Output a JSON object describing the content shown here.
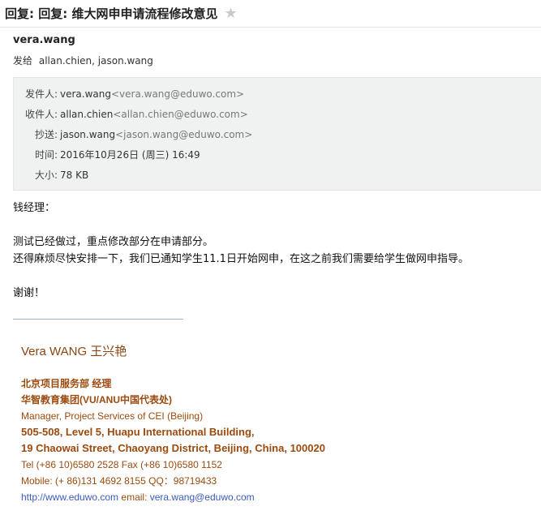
{
  "subject": "回复: 回复: 维大网申申请流程修改意见",
  "sender": "vera.wang",
  "to_line": {
    "label": "发给",
    "value": "allan.chien, jason.wang"
  },
  "details": [
    {
      "label": "发件人:",
      "value": "vera.wang",
      "addr": "<vera.wang@eduwo.com>"
    },
    {
      "label": "收件人:",
      "value": "allan.chien",
      "addr": "<allan.chien@eduwo.com>"
    },
    {
      "label": "抄送:",
      "value": "jason.wang",
      "addr": "<jason.wang@eduwo.com>"
    },
    {
      "label": "时间:",
      "value": "2016年10月26日 (周三) 16:49",
      "addr": ""
    },
    {
      "label": "大小:",
      "value": "78 KB",
      "addr": ""
    }
  ],
  "body": {
    "greeting": "钱经理：",
    "line1": "测试已经做过，重点修改部分在申请部分。",
    "line2": "还得麻烦尽快安排一下，我们已通知学生11.1日开始网申，在这之前我们需要给学生做网申指导。",
    "thanks": "谢谢！"
  },
  "signature": {
    "name": "Vera WANG  王兴艳",
    "dept": "北京项目服务部  经理",
    "company": "华智教育集团(VU/ANU中国代表处)",
    "title_en": "Manager, Project Services of CEI (Beijing)",
    "addr1": "505-508, Level 5, Huapu International Building,",
    "addr2": "19 Chaowai Street, Chaoyang District, Beijing, China, 100020",
    "tel": "Tel (+86 10)6580 2528  Fax (+86 10)6580 1152",
    "mobile": "Mobile: (+ 86)131 4692 8155  QQ：98719433",
    "website": "http://www.eduwo.com",
    "email_label": " email: ",
    "email": "vera.wang@eduwo.com"
  },
  "colors": {
    "signature_text": "#9c4a0e",
    "link": "#3a5bbd",
    "details_bg": "#f0f2f1"
  }
}
